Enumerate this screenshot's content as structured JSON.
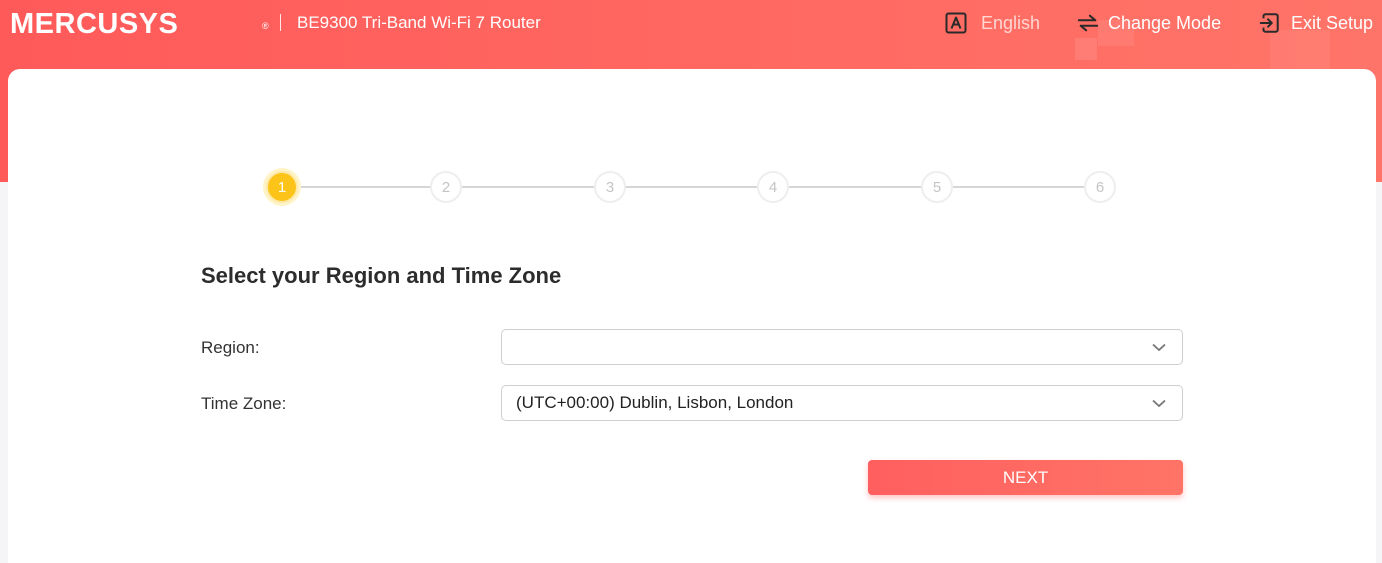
{
  "header": {
    "logo": "MERCUSYS",
    "logo_mark": "®",
    "product": "BE9300 Tri-Band Wi-Fi 7 Router",
    "language": {
      "label": "English",
      "icon": "language-icon"
    },
    "change_mode": {
      "label": "Change Mode",
      "icon": "swap-icon"
    },
    "exit_setup": {
      "label": "Exit Setup",
      "icon": "exit-icon"
    }
  },
  "stepper": {
    "current": 1,
    "steps": [
      "1",
      "2",
      "3",
      "4",
      "5",
      "6"
    ]
  },
  "form": {
    "title": "Select your Region and Time Zone",
    "region": {
      "label": "Region:",
      "value": ""
    },
    "timezone": {
      "label": "Time Zone:",
      "value": "(UTC+00:00) Dublin, Lisbon, London"
    },
    "next_label": "NEXT"
  },
  "colors": {
    "brand": "#ff5a5a",
    "active_step": "#fcc419",
    "button": "#ff6a62"
  }
}
